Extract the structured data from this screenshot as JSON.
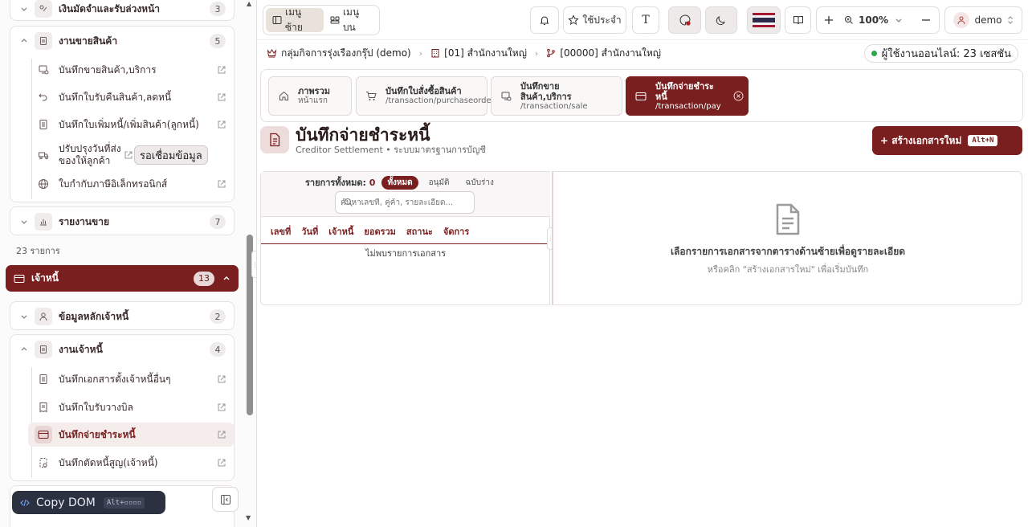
{
  "sidebar": {
    "top_group": {
      "label": "เงินมัดจำและรับล่วงหน้า",
      "count": "3"
    },
    "sales_group": {
      "label": "งานขายสินค้า",
      "count": "5",
      "items": [
        {
          "label": "บันทึกขายสินค้า,บริการ"
        },
        {
          "label": "บันทึกใบรับคืนสินค้า,ลดหนี้"
        },
        {
          "label": "บันทึกใบเพิ่มหนี้/เพิ่มสินค้า(ลูกหนี้)"
        },
        {
          "label": "ปรับปรุงวันที่ส่งของให้ลูกค้า"
        },
        {
          "label": "ใบกำกับภาษีอิเล็กทรอนิกส์"
        }
      ],
      "tooltip": "รอเชื่อมข้อมูล"
    },
    "report_group": {
      "label": "รายงานขาย",
      "count": "7"
    },
    "count_text": "23 รายการ",
    "creditor_section": {
      "label": "เจ้าหนี้",
      "count": "13"
    },
    "creditor_master": {
      "label": "ข้อมูลหลักเจ้าหนี้",
      "count": "2"
    },
    "creditor_work": {
      "label": "งานเจ้าหนี้",
      "count": "4",
      "items": [
        {
          "label": "บันทึกเอกสารตั้งเจ้าหนี้อื่นๆ"
        },
        {
          "label": "บันทึกใบรับวางบิล"
        },
        {
          "label": "บันทึกจ่ายชำระหนี้"
        },
        {
          "label": "บันทึกตัดหนี้สูญ(เจ้าหนี้)"
        }
      ]
    },
    "copy_dom": {
      "label": "Copy DOM",
      "shortcut": "Alt+▫▫▫▫"
    }
  },
  "topbar": {
    "menu_left": "เมนูซ้าย",
    "menu_top": "เมนูบน",
    "favorites": "ใช้ประจำ",
    "font_btn": "T",
    "zoom": "100%",
    "user": "demo"
  },
  "breadcrumb": {
    "company": "กลุ่มกิจการรุ่งเรืองกรุ๊ป (demo)",
    "branch": "[01] สำนักงานใหญ่",
    "dept": "[00000] สำนักงานใหญ่"
  },
  "online": "ผู้ใช้งานออนไลน์: 23 เซสชัน",
  "tabs": [
    {
      "title": "ภาพรวม",
      "sub": "หน้าแรก"
    },
    {
      "title": "บันทึกใบสั่งซื้อสินค้า",
      "sub": "/transaction/purchaseorder"
    },
    {
      "title": "บันทึกขาย",
      "title2": "สินค้า,บริการ",
      "sub": "/transaction/sale"
    },
    {
      "title": "บันทึกจ่ายชำระหนี้",
      "sub": "/transaction/pay"
    }
  ],
  "page": {
    "title": "บันทึกจ่ายชำระหนี้",
    "subtitle": "Creditor Settlement • ระบบมาตรฐานการบัญชี",
    "create_label": "+ สร้างเอกสารใหม่",
    "create_shortcut": "Alt+N"
  },
  "list": {
    "total_label": "รายการทั้งหมด:",
    "total_value": "0",
    "filters": [
      "ทั้งหมด",
      "อนุมัติ",
      "ฉบับร่าง"
    ],
    "search_placeholder": "ค้นหาเลขที่, คู่ค้า, รายละเอียด...",
    "columns": [
      "เลขที่",
      "วันที่",
      "เจ้าหนี้",
      "ยอดรวม",
      "สถานะ",
      "จัดการ"
    ],
    "empty": "ไม่พบรายการเอกสาร"
  },
  "detail": {
    "message": "เลือกรายการเอกสารจากตารางด้านซ้ายเพื่อดูรายละเอียด",
    "hint": "หรือคลิก \"สร้างเอกสารใหม่\" เพื่อเริ่มบันทึก"
  },
  "colors": {
    "accent": "#7a1f1f",
    "online": "#2aa84a"
  }
}
